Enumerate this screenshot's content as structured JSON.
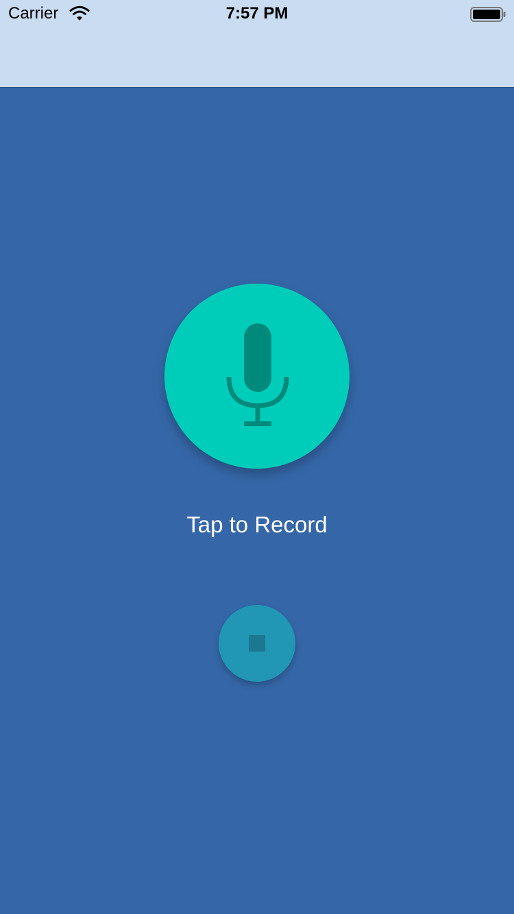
{
  "status_bar": {
    "carrier": "Carrier",
    "time": "7:57 PM",
    "wifi_icon": "wifi-icon",
    "battery_icon": "battery-icon"
  },
  "recorder": {
    "record_button_icon": "microphone-icon",
    "record_label": "Tap to Record",
    "stop_button_icon": "stop-icon"
  },
  "colors": {
    "top_bar": "#c9dcf1",
    "background": "#3567a8",
    "record_button": "#00cdb9",
    "mic_icon": "#008a7c",
    "stop_button": "#2196b5",
    "stop_icon": "#1b7890",
    "label_text": "#ffffff"
  }
}
